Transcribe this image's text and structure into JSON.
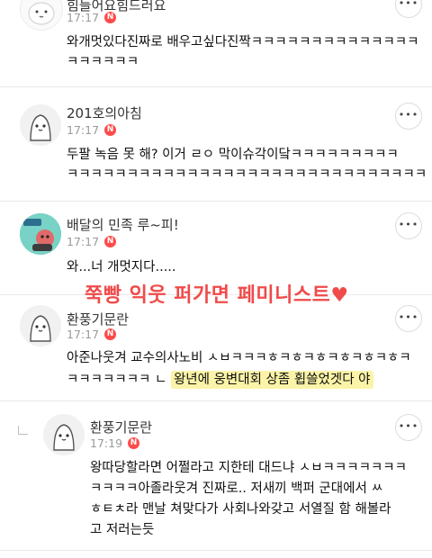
{
  "comments": [
    {
      "username": "힘들어요힘드러요",
      "time": "17:17",
      "badge": "N",
      "lines": [
        "와개멋있다진짜로 배우고싶다진짝ㅋㅋㅋㅋㅋㅋㅋㅋㅋㅋㅋㅋㅋㅋ",
        "ㅋㅋㅋㅋㅋㅋ"
      ],
      "more": "•••"
    },
    {
      "username": "201호의아침",
      "time": "17:17",
      "badge": "N",
      "lines": [
        "두팔 녹음 못 해? 이거 ㄹㅇ 막이슈각이닼ㅋㅋㅋㅋㅋㅋㅋㅋㅋ",
        "ㅋㅋㅋㅋㅋㅋㅋㅋㅋㅋㅋㅋㅋㅋㅋㅋㅋㅋㅋㅋㅋㅋㅋㅋㅋㅋㅋㅋㅋㅋ"
      ],
      "more": "•••"
    },
    {
      "username": "배달의 민족 루~피!",
      "time": "17:17",
      "badge": "N",
      "lines": [
        "와...너 개멋지다....."
      ],
      "more": "•••"
    },
    {
      "username": "환풍기문란",
      "time": "17:17",
      "badge": "N",
      "line1": "아준나웃겨 교수의사노비 ㅅㅂㅋㅋㅋㅎㅋㅎㅋㅎㅋㅎㅋㅎㅋㅎㅋ",
      "line2_plain": "ㅋㅋㅋㅋㅋㅋㅋ ㄴ",
      "line2_highlight": "왕년에 웅변대회 상좀 휩쓸었겟다 야",
      "more": "•••"
    },
    {
      "username": "환풍기문란",
      "time": "17:19",
      "badge": "N",
      "lines": [
        "왕따당할라면 어쩔라고 지한테 대드냐 ㅅㅂㅋㅋㅋㅋㅋㅋㅋ",
        "ㅋㅋㅋㅋ아졸라웃겨 진짜로..  저새끼 백퍼 군대에서 ㅆ",
        "ㅎㅌㅊ라 맨날 쳐맞다가 사회나와갖고 서열질 함 해볼라",
        "고 저러는듯"
      ],
      "more": "•••"
    }
  ],
  "overlay_caption": "쭉빵 익웃 퍼가면 페미니스트♥"
}
